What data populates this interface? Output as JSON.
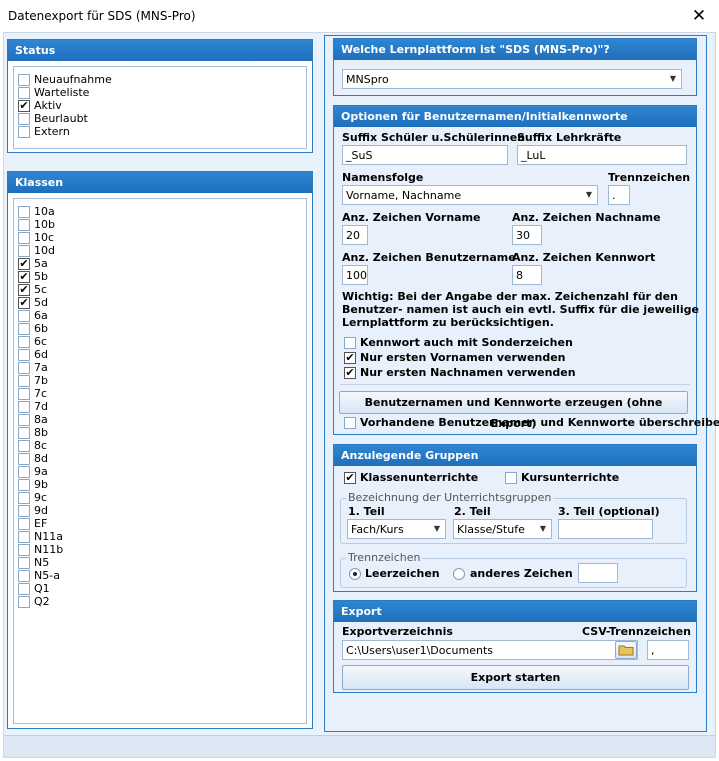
{
  "window": {
    "title": "Datenexport für SDS (MNS-Pro)",
    "close_glyph": "✕"
  },
  "status": {
    "header": "Status",
    "items": [
      {
        "label": "Neuaufnahme",
        "checked": false
      },
      {
        "label": "Warteliste",
        "checked": false
      },
      {
        "label": "Aktiv",
        "checked": true
      },
      {
        "label": "Beurlaubt",
        "checked": false
      },
      {
        "label": "Extern",
        "checked": false
      }
    ]
  },
  "klassen": {
    "header": "Klassen",
    "items": [
      {
        "label": "10a",
        "checked": false
      },
      {
        "label": "10b",
        "checked": false
      },
      {
        "label": "10c",
        "checked": false
      },
      {
        "label": "10d",
        "checked": false
      },
      {
        "label": "5a",
        "checked": true
      },
      {
        "label": "5b",
        "checked": true
      },
      {
        "label": "5c",
        "checked": true
      },
      {
        "label": "5d",
        "checked": true
      },
      {
        "label": "6a",
        "checked": false
      },
      {
        "label": "6b",
        "checked": false
      },
      {
        "label": "6c",
        "checked": false
      },
      {
        "label": "6d",
        "checked": false
      },
      {
        "label": "7a",
        "checked": false
      },
      {
        "label": "7b",
        "checked": false
      },
      {
        "label": "7c",
        "checked": false
      },
      {
        "label": "7d",
        "checked": false
      },
      {
        "label": "8a",
        "checked": false
      },
      {
        "label": "8b",
        "checked": false
      },
      {
        "label": "8c",
        "checked": false
      },
      {
        "label": "8d",
        "checked": false
      },
      {
        "label": "9a",
        "checked": false
      },
      {
        "label": "9b",
        "checked": false
      },
      {
        "label": "9c",
        "checked": false
      },
      {
        "label": "9d",
        "checked": false
      },
      {
        "label": "EF",
        "checked": false
      },
      {
        "label": "N11a",
        "checked": false
      },
      {
        "label": "N11b",
        "checked": false
      },
      {
        "label": "N5",
        "checked": false
      },
      {
        "label": "N5-a",
        "checked": false
      },
      {
        "label": "Q1",
        "checked": false
      },
      {
        "label": "Q2",
        "checked": false
      }
    ]
  },
  "platform": {
    "header": "Welche Lernplattform ist \"SDS (MNS-Pro)\"?",
    "selected": "MNSpro"
  },
  "options": {
    "header": "Optionen für Benutzernamen/Initialkennworte",
    "suffix_students_label": "Suffix Schüler u.Schülerinnen",
    "suffix_students_value": "_SuS",
    "suffix_teachers_label": "Suffix Lehrkräfte",
    "suffix_teachers_value": "_LuL",
    "name_order_label": "Namensfolge",
    "name_order_value": "Vorname, Nachname",
    "separator_label": "Trennzeichen",
    "separator_value": ".",
    "first_name_chars_label": "Anz. Zeichen Vorname",
    "first_name_chars_value": "20",
    "last_name_chars_label": "Anz. Zeichen Nachname",
    "last_name_chars_value": "30",
    "username_chars_label": "Anz. Zeichen Benutzername",
    "username_chars_value": "100",
    "password_chars_label": "Anz. Zeichen Kennwort",
    "password_chars_value": "8",
    "note_line1": "Wichtig: Bei der Angabe der max. Zeichenzahl für den",
    "note_line2": "Benutzer- namen ist auch ein evtl. Suffix für die jeweilige",
    "note_line3": "Lernplattform zu berücksichtigen.",
    "cb_special_label": "Kennwort auch mit Sonderzeichen",
    "cb_special_checked": false,
    "cb_first_given_label": "Nur ersten Vornamen verwenden",
    "cb_first_given_checked": true,
    "cb_first_family_label": "Nur ersten Nachnamen verwenden",
    "cb_first_family_checked": true,
    "generate_button": "Benutzernamen und Kennworte erzeugen (ohne Export)",
    "cb_overwrite_label": "Vorhandene Benutzernamen und Kennworte überschreiben",
    "cb_overwrite_checked": false
  },
  "groups": {
    "header": "Anzulegende Gruppen",
    "cb_klassen_label": "Klassenunterrichte",
    "cb_klassen_checked": true,
    "cb_kurse_label": "Kursunterrichte",
    "cb_kurse_checked": false,
    "naming_group_title": "Bezeichnung der Unterrichtsgruppen",
    "part1_label": "1. Teil",
    "part1_value": "Fach/Kurs",
    "part2_label": "2. Teil",
    "part2_value": "Klasse/Stufe",
    "part3_label": "3. Teil (optional)",
    "part3_value": "",
    "separator_group_title": "Trennzeichen",
    "radio_space_label": "Leerzeichen",
    "radio_space_selected": true,
    "radio_other_label": "anderes Zeichen",
    "radio_other_selected": false,
    "other_char_value": ""
  },
  "export": {
    "header": "Export",
    "dir_label": "Exportverzeichnis",
    "dir_value": "C:\\Users\\user1\\Documents",
    "csv_sep_label": "CSV-Trennzeichen",
    "csv_sep_value": ",",
    "start_button": "Export starten"
  },
  "glyphs": {
    "check": "✔",
    "dropdown_arrow": "▼"
  },
  "icons": {
    "folder": "folder-icon"
  },
  "colors": {
    "accent": "#2c7bc6",
    "header_top": "#2f86d2",
    "header_bottom": "#1f6fbc",
    "folder": "#e8c35a"
  }
}
